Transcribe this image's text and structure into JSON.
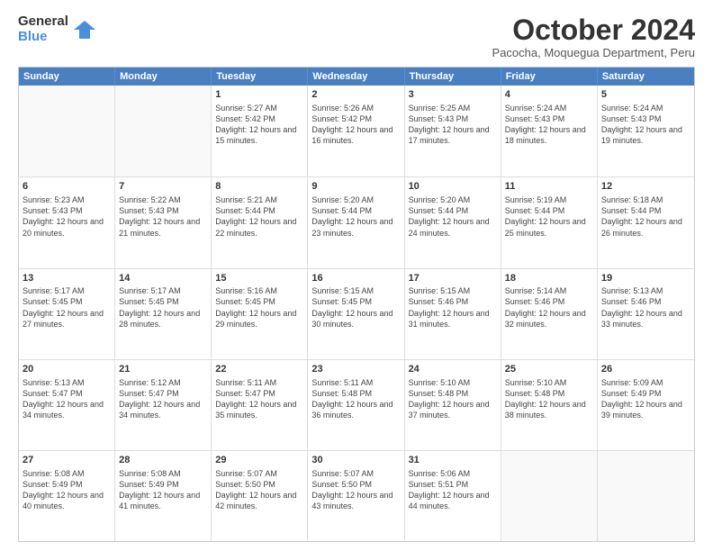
{
  "logo": {
    "general": "General",
    "blue": "Blue"
  },
  "title": "October 2024",
  "subtitle": "Pacocha, Moquegua Department, Peru",
  "header_days": [
    "Sunday",
    "Monday",
    "Tuesday",
    "Wednesday",
    "Thursday",
    "Friday",
    "Saturday"
  ],
  "weeks": [
    [
      {
        "day": "",
        "sunrise": "",
        "sunset": "",
        "daylight": "",
        "empty": true
      },
      {
        "day": "",
        "sunrise": "",
        "sunset": "",
        "daylight": "",
        "empty": true
      },
      {
        "day": "1",
        "sunrise": "Sunrise: 5:27 AM",
        "sunset": "Sunset: 5:42 PM",
        "daylight": "Daylight: 12 hours and 15 minutes."
      },
      {
        "day": "2",
        "sunrise": "Sunrise: 5:26 AM",
        "sunset": "Sunset: 5:42 PM",
        "daylight": "Daylight: 12 hours and 16 minutes."
      },
      {
        "day": "3",
        "sunrise": "Sunrise: 5:25 AM",
        "sunset": "Sunset: 5:43 PM",
        "daylight": "Daylight: 12 hours and 17 minutes."
      },
      {
        "day": "4",
        "sunrise": "Sunrise: 5:24 AM",
        "sunset": "Sunset: 5:43 PM",
        "daylight": "Daylight: 12 hours and 18 minutes."
      },
      {
        "day": "5",
        "sunrise": "Sunrise: 5:24 AM",
        "sunset": "Sunset: 5:43 PM",
        "daylight": "Daylight: 12 hours and 19 minutes."
      }
    ],
    [
      {
        "day": "6",
        "sunrise": "Sunrise: 5:23 AM",
        "sunset": "Sunset: 5:43 PM",
        "daylight": "Daylight: 12 hours and 20 minutes."
      },
      {
        "day": "7",
        "sunrise": "Sunrise: 5:22 AM",
        "sunset": "Sunset: 5:43 PM",
        "daylight": "Daylight: 12 hours and 21 minutes."
      },
      {
        "day": "8",
        "sunrise": "Sunrise: 5:21 AM",
        "sunset": "Sunset: 5:44 PM",
        "daylight": "Daylight: 12 hours and 22 minutes."
      },
      {
        "day": "9",
        "sunrise": "Sunrise: 5:20 AM",
        "sunset": "Sunset: 5:44 PM",
        "daylight": "Daylight: 12 hours and 23 minutes."
      },
      {
        "day": "10",
        "sunrise": "Sunrise: 5:20 AM",
        "sunset": "Sunset: 5:44 PM",
        "daylight": "Daylight: 12 hours and 24 minutes."
      },
      {
        "day": "11",
        "sunrise": "Sunrise: 5:19 AM",
        "sunset": "Sunset: 5:44 PM",
        "daylight": "Daylight: 12 hours and 25 minutes."
      },
      {
        "day": "12",
        "sunrise": "Sunrise: 5:18 AM",
        "sunset": "Sunset: 5:44 PM",
        "daylight": "Daylight: 12 hours and 26 minutes."
      }
    ],
    [
      {
        "day": "13",
        "sunrise": "Sunrise: 5:17 AM",
        "sunset": "Sunset: 5:45 PM",
        "daylight": "Daylight: 12 hours and 27 minutes."
      },
      {
        "day": "14",
        "sunrise": "Sunrise: 5:17 AM",
        "sunset": "Sunset: 5:45 PM",
        "daylight": "Daylight: 12 hours and 28 minutes."
      },
      {
        "day": "15",
        "sunrise": "Sunrise: 5:16 AM",
        "sunset": "Sunset: 5:45 PM",
        "daylight": "Daylight: 12 hours and 29 minutes."
      },
      {
        "day": "16",
        "sunrise": "Sunrise: 5:15 AM",
        "sunset": "Sunset: 5:45 PM",
        "daylight": "Daylight: 12 hours and 30 minutes."
      },
      {
        "day": "17",
        "sunrise": "Sunrise: 5:15 AM",
        "sunset": "Sunset: 5:46 PM",
        "daylight": "Daylight: 12 hours and 31 minutes."
      },
      {
        "day": "18",
        "sunrise": "Sunrise: 5:14 AM",
        "sunset": "Sunset: 5:46 PM",
        "daylight": "Daylight: 12 hours and 32 minutes."
      },
      {
        "day": "19",
        "sunrise": "Sunrise: 5:13 AM",
        "sunset": "Sunset: 5:46 PM",
        "daylight": "Daylight: 12 hours and 33 minutes."
      }
    ],
    [
      {
        "day": "20",
        "sunrise": "Sunrise: 5:13 AM",
        "sunset": "Sunset: 5:47 PM",
        "daylight": "Daylight: 12 hours and 34 minutes."
      },
      {
        "day": "21",
        "sunrise": "Sunrise: 5:12 AM",
        "sunset": "Sunset: 5:47 PM",
        "daylight": "Daylight: 12 hours and 34 minutes."
      },
      {
        "day": "22",
        "sunrise": "Sunrise: 5:11 AM",
        "sunset": "Sunset: 5:47 PM",
        "daylight": "Daylight: 12 hours and 35 minutes."
      },
      {
        "day": "23",
        "sunrise": "Sunrise: 5:11 AM",
        "sunset": "Sunset: 5:48 PM",
        "daylight": "Daylight: 12 hours and 36 minutes."
      },
      {
        "day": "24",
        "sunrise": "Sunrise: 5:10 AM",
        "sunset": "Sunset: 5:48 PM",
        "daylight": "Daylight: 12 hours and 37 minutes."
      },
      {
        "day": "25",
        "sunrise": "Sunrise: 5:10 AM",
        "sunset": "Sunset: 5:48 PM",
        "daylight": "Daylight: 12 hours and 38 minutes."
      },
      {
        "day": "26",
        "sunrise": "Sunrise: 5:09 AM",
        "sunset": "Sunset: 5:49 PM",
        "daylight": "Daylight: 12 hours and 39 minutes."
      }
    ],
    [
      {
        "day": "27",
        "sunrise": "Sunrise: 5:08 AM",
        "sunset": "Sunset: 5:49 PM",
        "daylight": "Daylight: 12 hours and 40 minutes."
      },
      {
        "day": "28",
        "sunrise": "Sunrise: 5:08 AM",
        "sunset": "Sunset: 5:49 PM",
        "daylight": "Daylight: 12 hours and 41 minutes."
      },
      {
        "day": "29",
        "sunrise": "Sunrise: 5:07 AM",
        "sunset": "Sunset: 5:50 PM",
        "daylight": "Daylight: 12 hours and 42 minutes."
      },
      {
        "day": "30",
        "sunrise": "Sunrise: 5:07 AM",
        "sunset": "Sunset: 5:50 PM",
        "daylight": "Daylight: 12 hours and 43 minutes."
      },
      {
        "day": "31",
        "sunrise": "Sunrise: 5:06 AM",
        "sunset": "Sunset: 5:51 PM",
        "daylight": "Daylight: 12 hours and 44 minutes."
      },
      {
        "day": "",
        "sunrise": "",
        "sunset": "",
        "daylight": "",
        "empty": true
      },
      {
        "day": "",
        "sunrise": "",
        "sunset": "",
        "daylight": "",
        "empty": true
      }
    ]
  ]
}
